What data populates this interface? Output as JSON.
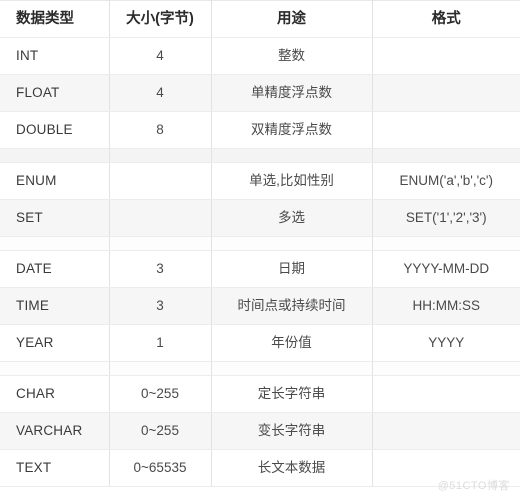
{
  "table": {
    "columns": [
      {
        "key": "type",
        "label": "数据类型"
      },
      {
        "key": "size",
        "label": "大小(字节)"
      },
      {
        "key": "usage",
        "label": "用途"
      },
      {
        "key": "format",
        "label": "格式"
      }
    ],
    "rows": [
      {
        "type": "INT",
        "size": "4",
        "usage": "整数",
        "format": ""
      },
      {
        "type": "FLOAT",
        "size": "4",
        "usage": "单精度浮点数",
        "format": ""
      },
      {
        "type": "DOUBLE",
        "size": "8",
        "usage": "双精度浮点数",
        "format": ""
      },
      {
        "type": "ENUM",
        "size": "",
        "usage": "单选,比如性别",
        "format": "ENUM('a','b','c')"
      },
      {
        "type": "SET",
        "size": "",
        "usage": "多选",
        "format": "SET('1','2','3')"
      },
      {
        "type": "DATE",
        "size": "3",
        "usage": "日期",
        "format": "YYYY-MM-DD"
      },
      {
        "type": "TIME",
        "size": "3",
        "usage": "时间点或持续时间",
        "format": "HH:MM:SS"
      },
      {
        "type": "YEAR",
        "size": "1",
        "usage": "年份值",
        "format": "YYYY"
      },
      {
        "type": "CHAR",
        "size": "0~255",
        "usage": "定长字符串",
        "format": ""
      },
      {
        "type": "VARCHAR",
        "size": "0~255",
        "usage": "变长字符串",
        "format": ""
      },
      {
        "type": "TEXT",
        "size": "0~65535",
        "usage": "长文本数据",
        "format": ""
      }
    ],
    "group_breaks_after": [
      2,
      4,
      7
    ]
  },
  "watermark": {
    "text": "@51CTO博客"
  },
  "colors": {
    "header_text": "#2b2b2b",
    "body_text": "#3a3a3a",
    "row_stripe": "#f6f6f7",
    "row_base": "#ffffff",
    "border": "#e2e2e4",
    "watermark": "#dcdcdc"
  }
}
